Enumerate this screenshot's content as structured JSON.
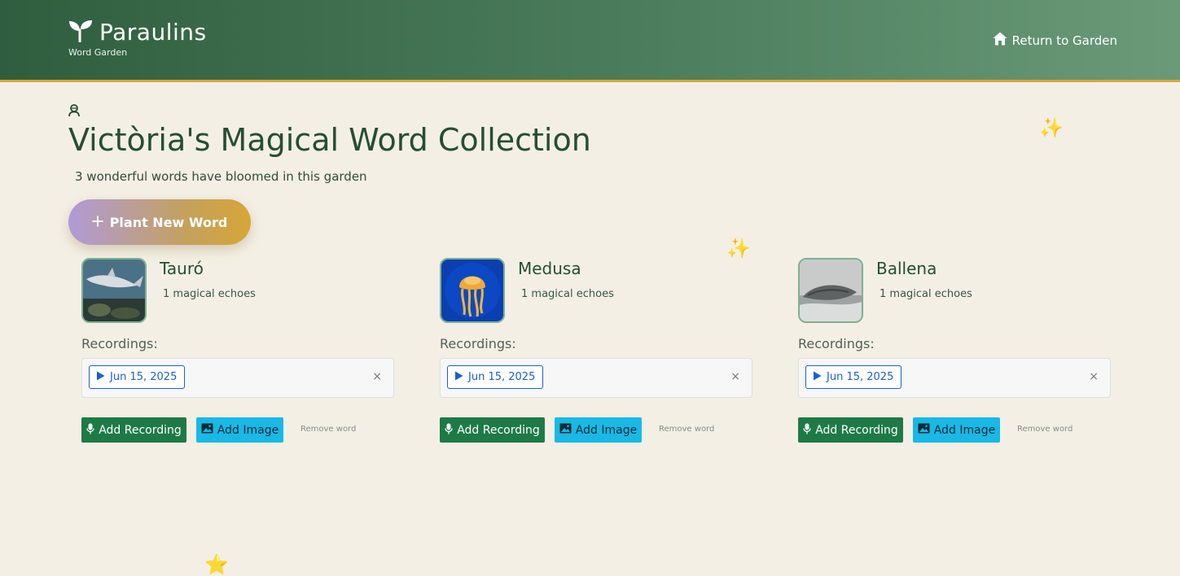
{
  "header": {
    "brand_name": "Paraulins",
    "brand_subtitle": "Word Garden",
    "return_label": "Return to Garden",
    "icons": {
      "logo": "sprout-icon",
      "return": "home-icon"
    }
  },
  "main": {
    "title": "Victòria's Magical Word Collection",
    "subtitle": "3 wonderful words have bloomed in this garden",
    "plant_button_label": "Plant New Word",
    "profile_icon": "user-icon"
  },
  "words": [
    {
      "name": "Tauró",
      "echoes": "1 magical echoes",
      "image": "shark-photo",
      "recordings_label": "Recordings:",
      "recordings": [
        "Jun 15, 2025"
      ],
      "remove_recording": "×",
      "add_recording_label": "Add Recording",
      "add_image_label": "Add Image",
      "remove_word_label": "Remove word"
    },
    {
      "name": "Medusa",
      "echoes": "1 magical echoes",
      "image": "jellyfish-photo",
      "recordings_label": "Recordings:",
      "recordings": [
        "Jun 15, 2025"
      ],
      "remove_recording": "×",
      "add_recording_label": "Add Recording",
      "add_image_label": "Add Image",
      "remove_word_label": "Remove word"
    },
    {
      "name": "Ballena",
      "echoes": "1 magical echoes",
      "image": "whale-photo",
      "recordings_label": "Recordings:",
      "recordings": [
        "Jun 15, 2025"
      ],
      "remove_recording": "×",
      "add_recording_label": "Add Recording",
      "add_image_label": "Add Image",
      "remove_word_label": "Remove word"
    }
  ],
  "colors": {
    "header_start": "#2f5e3f",
    "header_end": "#6a9a78",
    "header_border": "#d4a83a",
    "background": "#f3efe4",
    "title": "#264d33",
    "record_button": "#1d7a46",
    "image_button": "#18b9e6",
    "chip": "#1a5fd0"
  }
}
